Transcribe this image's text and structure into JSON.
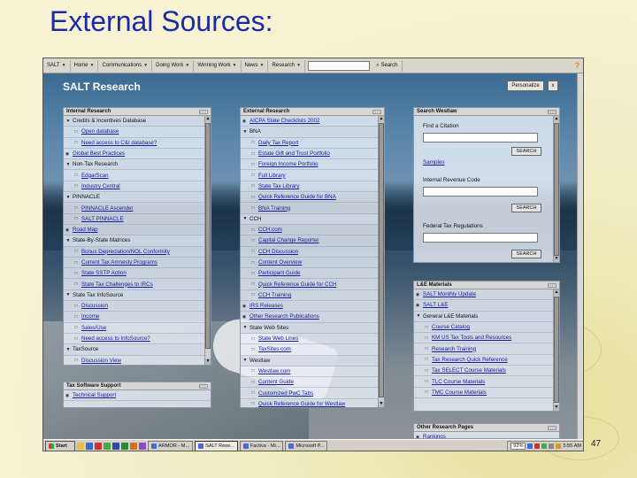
{
  "slide": {
    "title": "External Sources:",
    "page_number": "47"
  },
  "menubar": {
    "items": [
      {
        "label": "SALT"
      },
      {
        "label": "Home"
      },
      {
        "label": "Communications"
      },
      {
        "label": "Doing Work"
      },
      {
        "label": "Winning Work"
      },
      {
        "label": "News"
      },
      {
        "label": "Research"
      }
    ],
    "search_label": "Search"
  },
  "portal": {
    "title": "SALT Research",
    "personalize_label": "Personalize",
    "close_label": "x"
  },
  "internal_research": {
    "title": "Internal Research",
    "rows": [
      {
        "text": "Credits & Incentives Database",
        "kind": "group"
      },
      {
        "text": "Open database",
        "kind": "item"
      },
      {
        "text": "Need access to C&I database?",
        "kind": "item"
      },
      {
        "text": "Global Best Practices",
        "kind": "lnk"
      },
      {
        "text": "Non-Tax Research",
        "kind": "group"
      },
      {
        "text": "EdgarScan",
        "kind": "item"
      },
      {
        "text": "Industry Central",
        "kind": "item"
      },
      {
        "text": "PINNACLE",
        "kind": "group"
      },
      {
        "text": "PINNACLE Ascender",
        "kind": "item"
      },
      {
        "text": "SALT PINNACLE",
        "kind": "item"
      },
      {
        "text": "Road Map",
        "kind": "lnk"
      },
      {
        "text": "State-By-State Matrices",
        "kind": "group"
      },
      {
        "text": "Bonus Depreciation/NOL Conformity",
        "kind": "item"
      },
      {
        "text": "Current Tax Amnesty Programs",
        "kind": "item"
      },
      {
        "text": "State SSTP Action",
        "kind": "item"
      },
      {
        "text": "State Tax Challenges to IRCs",
        "kind": "item"
      },
      {
        "text": "State Tax InfoSource",
        "kind": "group"
      },
      {
        "text": "Discussion",
        "kind": "item"
      },
      {
        "text": "Income",
        "kind": "item"
      },
      {
        "text": "Sales/Use",
        "kind": "item"
      },
      {
        "text": "Need access to InfoSource?",
        "kind": "item"
      },
      {
        "text": "TaxSource",
        "kind": "group"
      },
      {
        "text": "Discussion View",
        "kind": "item"
      }
    ]
  },
  "tax_software_support": {
    "title": "Tax Software Support",
    "rows": [
      {
        "text": "Technical Support",
        "kind": "lnk"
      }
    ]
  },
  "external_research": {
    "title": "External Research",
    "rows": [
      {
        "text": "AICPA State Checklists 2002",
        "kind": "lnk"
      },
      {
        "text": "BNA",
        "kind": "group"
      },
      {
        "text": "Daily Tax Report",
        "kind": "item"
      },
      {
        "text": "Estate Gift and Trust Portfolio",
        "kind": "item"
      },
      {
        "text": "Foreign Income Portfolio",
        "kind": "item"
      },
      {
        "text": "Full Library",
        "kind": "item"
      },
      {
        "text": "State Tax Library",
        "kind": "item"
      },
      {
        "text": "Quick Reference Guide for BNA",
        "kind": "item"
      },
      {
        "text": "BNA Training",
        "kind": "item"
      },
      {
        "text": "CCH",
        "kind": "group"
      },
      {
        "text": "CCH.com",
        "kind": "item"
      },
      {
        "text": "Capital Change Reporter",
        "kind": "item"
      },
      {
        "text": "CCH Discussion",
        "kind": "item"
      },
      {
        "text": "Content Overview",
        "kind": "item"
      },
      {
        "text": "Participant Guide",
        "kind": "item"
      },
      {
        "text": "Quick Reference Guide for CCH",
        "kind": "item"
      },
      {
        "text": "CCH Training",
        "kind": "item"
      },
      {
        "text": "IRS Releases",
        "kind": "lnk"
      },
      {
        "text": "Other Research Publications",
        "kind": "lnk"
      },
      {
        "text": "State Web Sites",
        "kind": "group"
      },
      {
        "text": "State Web Lines",
        "kind": "item"
      },
      {
        "text": "TaxSites.com",
        "kind": "item"
      },
      {
        "text": "Westlaw",
        "kind": "group"
      },
      {
        "text": "Westlaw.com",
        "kind": "item"
      },
      {
        "text": "Content Guide",
        "kind": "item"
      },
      {
        "text": "Customized PwC Tabs",
        "kind": "item"
      },
      {
        "text": "Quick Reference Guide for Westlaw",
        "kind": "item"
      }
    ]
  },
  "search_westlaw": {
    "title": "Search Westlaw",
    "find_citation": "Find a Citation",
    "samples": "Samples",
    "irc_label": "Internal Revenue Code",
    "ftr_label": "Federal Tax Regulations",
    "button_label": "SEARCH"
  },
  "le_materials": {
    "title": "L&E Materials",
    "rows": [
      {
        "text": "SALT Monthly Update",
        "kind": "lnk"
      },
      {
        "text": "SALT L&E",
        "kind": "lnk"
      },
      {
        "text": "General L&E Materials",
        "kind": "group"
      },
      {
        "text": "Course Catalog",
        "kind": "item"
      },
      {
        "text": "KM US Tax Tools and Resources",
        "kind": "item"
      },
      {
        "text": "Research Training",
        "kind": "item"
      },
      {
        "text": "Tax Research Quick Reference",
        "kind": "item"
      },
      {
        "text": "Tax SELECT Course Materials",
        "kind": "item"
      },
      {
        "text": "TLC Course Materials",
        "kind": "item"
      },
      {
        "text": "TMC Course Materials",
        "kind": "item"
      }
    ]
  },
  "other_research_pages": {
    "title": "Other Research Pages",
    "rows": [
      {
        "text": "Rankings",
        "kind": "lnk"
      }
    ]
  },
  "taskbar": {
    "start_label": "Start",
    "tasks": [
      {
        "label": "ARMOR - M...",
        "active": false
      },
      {
        "label": "SALT Rese...",
        "active": true
      },
      {
        "label": "Factiva - Mi...",
        "active": false
      },
      {
        "label": "Microsoft P...",
        "active": false
      }
    ],
    "zoom": "92%",
    "clock": "5:55 AM"
  },
  "colors": {
    "title_blue": "#1b2aa8",
    "link_blue": "#1a1a9a",
    "slide_bg": "#f3efc5"
  }
}
